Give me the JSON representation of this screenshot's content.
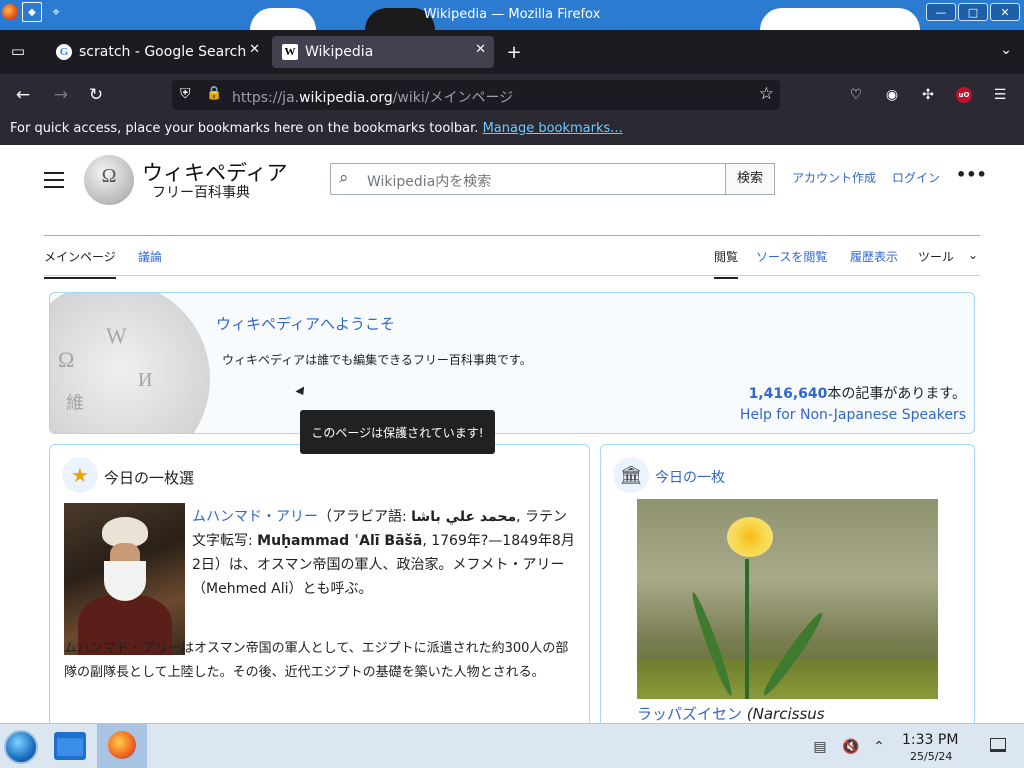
{
  "window": {
    "title": "Wikipedia — Mozilla Firefox",
    "buttons": {
      "minimize": "—",
      "maximize": "□",
      "close": "✕"
    }
  },
  "tabs": [
    {
      "label": "scratch - Google Search",
      "favicon": "G",
      "favicon_color": "#4285f4",
      "active": false
    },
    {
      "label": "Wikipedia",
      "favicon": "W",
      "active": true
    }
  ],
  "tabbar": {
    "new_tab": "+",
    "list_all_tabs": "⌄"
  },
  "navbar": {
    "url_prefix": "https://ja.",
    "url_domain": "wikipedia.org",
    "url_path": "/wiki/メインページ"
  },
  "bookmarks": {
    "message": "For quick access, place your bookmarks here on the bookmarks toolbar. ",
    "manage_link": "Manage bookmarks..."
  },
  "wiki": {
    "wordmark": "ウィキペディア",
    "tagline": "フリー百科事典",
    "search_placeholder": "Wikipedia内を検索",
    "search_button": "検索",
    "header_links": [
      "アカウント作成",
      "ログイン"
    ],
    "more_menu": "•••",
    "page_tabs_left": [
      "メインページ",
      "議論"
    ],
    "page_tabs_right": [
      "閲覧",
      "ソースを閲覧",
      "履歴表示",
      "ツール"
    ],
    "welcome_title": "ウィキペディアへようこそ",
    "welcome_desc": "ウィキペディアは誰でも編集できるフリー百科事典です。",
    "article_count_number": "1,416,640",
    "article_count_suffix": "本の記事があります。",
    "help_link": "Help for Non-Japanese Speakers",
    "tooltip": "このページは保護されています!",
    "featured_heading": "今日の一枚選",
    "featured_lead_link": "ムハンマド・アリー",
    "featured_text_a": "（アラビア語: ",
    "featured_arabic": "محمد علي باشا",
    "featured_text_b": ", ラテン文字転写: ",
    "featured_latin": "Muḥammad ʿAlī Bāšā",
    "featured_text_c": ", 1769年?—1849年8月2日）は、オスマン帝国の軍人、政治家。メフメト・アリー",
    "featured_text_d": "（Mehmed Ali）とも呼ぶ。",
    "featured_text2_a": "ムハンマド・アリーはオスマン帝国の軍人として、エジプトに派遣された約",
    "featured_number": "300人",
    "featured_text2_b": "の部隊の副隊長として上陸した。その後、近代エジプトの基礎を築いた人物とされる。",
    "today_heading": "今日の一枚",
    "today_caption_link": "ラッパズイセン",
    "today_caption_latin": "(Narcissus"
  },
  "taskbar": {
    "time": "1:33 PM",
    "date": "25/5/24"
  },
  "colors": {
    "titlebar": "#2b7bd0",
    "tabstrip": "#1c1b22",
    "navbar": "#2b2a33",
    "wiki_link": "#3366cc",
    "box_border": "#a7d7f9"
  }
}
